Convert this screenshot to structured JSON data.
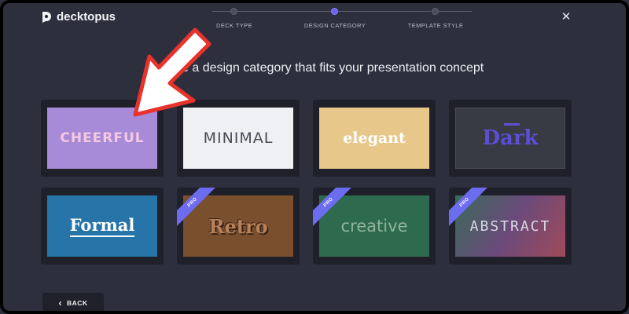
{
  "app": {
    "brand": "decktopus",
    "close_glyph": "✕"
  },
  "steps": [
    {
      "label": "DECK TYPE",
      "state": "done"
    },
    {
      "label": "DESIGN CATEGORY",
      "state": "active"
    },
    {
      "label": "TEMPLATE STYLE",
      "state": "upcoming"
    }
  ],
  "headline": "Choose a design category that fits your presentation concept",
  "categories": [
    {
      "label": "CHEERFUL",
      "pro": false,
      "bg": "#a78ad8"
    },
    {
      "label": "MINIMAL",
      "pro": false,
      "bg": "#eef0f4"
    },
    {
      "label": "elegant",
      "pro": false,
      "bg": "#e8c88a"
    },
    {
      "label": "Dark",
      "pro": false,
      "bg": "#383a44"
    },
    {
      "label": "Formal",
      "pro": false,
      "bg": "#2674a8"
    },
    {
      "label": "Retro",
      "pro": true,
      "bg": "#7a4f2e"
    },
    {
      "label": "creative",
      "pro": true,
      "bg": "#2e6b4e"
    },
    {
      "label": "ABSTRACT",
      "pro": true,
      "bg": "#6a4a6e"
    }
  ],
  "pro_badge": "PRO",
  "back_label": "BACK",
  "back_glyph": "‹",
  "colors": {
    "accent": "#6b63ee",
    "pro_ribbon": "#6c6cf0",
    "arrow": "#e8322c"
  },
  "icons": {
    "logo": "decktopus-logo-icon",
    "close": "close-icon",
    "back": "chevron-left-icon",
    "annotation": "red-arrow-annotation"
  }
}
